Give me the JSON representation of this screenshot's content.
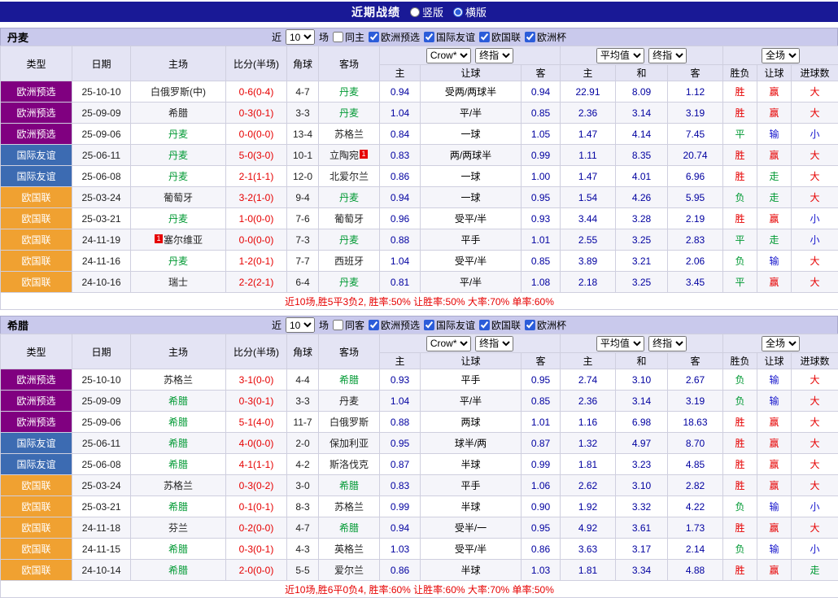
{
  "top_bar": {
    "title": "近期战绩",
    "layout_options": [
      {
        "label": "竖版",
        "selected": false
      },
      {
        "label": "横版",
        "selected": true
      }
    ]
  },
  "filter": {
    "near_label": "近",
    "count_value": "10",
    "games_label": "场",
    "league_filters": [
      {
        "label": "欧洲预选",
        "checked": true
      },
      {
        "label": "国际友谊",
        "checked": true
      },
      {
        "label": "欧国联",
        "checked": true
      },
      {
        "label": "欧洲杯",
        "checked": true
      }
    ]
  },
  "table_header": {
    "type": "类型",
    "date": "日期",
    "home": "主场",
    "score": "比分(半场)",
    "corner": "角球",
    "away": "客场",
    "odds_select": "Crow*",
    "odds_stage_select": "终指",
    "avg_select": "平均值",
    "avg_stage_select": "终指",
    "scope_select": "全场",
    "odds_home": "主",
    "odds_handicap": "让球",
    "odds_away": "客",
    "avg_home": "主",
    "avg_draw": "和",
    "avg_away": "客",
    "result": "胜负",
    "handicap_result": "让球",
    "goals": "进球数"
  },
  "colors": {
    "badges": {
      "欧洲预选": "#800080",
      "国际友谊": "#3c6bb2",
      "欧国联": "#f0a131"
    },
    "result": {
      "r": "#e60000",
      "g": "#009933",
      "b": "#1515cc"
    },
    "focus_team": "#009933",
    "score": "#e60000",
    "odds": "#0000a0",
    "topbar_bg": "#191996",
    "section_bar_bg": "#c9c9ec",
    "header_bg": "#e4e4f4"
  },
  "sections": [
    {
      "team": "丹麦",
      "same_side_label": "同主",
      "same_side_checked": false,
      "summary": "近10场,胜5平3负2, 胜率:50% 让胜率:50% 大率:70% 单率:60%",
      "rows": [
        {
          "type": "欧洲预选",
          "date": "25-10-10",
          "home": "白俄罗斯(中)",
          "home_focus": false,
          "home_card": "",
          "score": "0-6(0-4)",
          "corner": "4-7",
          "away": "丹麦",
          "away_focus": true,
          "away_card": "",
          "odds": [
            "0.94",
            "受两/两球半",
            "0.94"
          ],
          "avg": [
            "22.91",
            "8.09",
            "1.12"
          ],
          "results": [
            {
              "t": "胜",
              "c": "r"
            },
            {
              "t": "赢",
              "c": "r"
            },
            {
              "t": "大",
              "c": "r"
            }
          ]
        },
        {
          "type": "欧洲预选",
          "date": "25-09-09",
          "home": "希腊",
          "home_focus": false,
          "home_card": "",
          "score": "0-3(0-1)",
          "corner": "3-3",
          "away": "丹麦",
          "away_focus": true,
          "away_card": "",
          "odds": [
            "1.04",
            "平/半",
            "0.85"
          ],
          "avg": [
            "2.36",
            "3.14",
            "3.19"
          ],
          "results": [
            {
              "t": "胜",
              "c": "r"
            },
            {
              "t": "赢",
              "c": "r"
            },
            {
              "t": "大",
              "c": "r"
            }
          ]
        },
        {
          "type": "欧洲预选",
          "date": "25-09-06",
          "home": "丹麦",
          "home_focus": true,
          "home_card": "",
          "score": "0-0(0-0)",
          "corner": "13-4",
          "away": "苏格兰",
          "away_focus": false,
          "away_card": "",
          "odds": [
            "0.84",
            "一球",
            "1.05"
          ],
          "avg": [
            "1.47",
            "4.14",
            "7.45"
          ],
          "results": [
            {
              "t": "平",
              "c": "g"
            },
            {
              "t": "输",
              "c": "b"
            },
            {
              "t": "小",
              "c": "b"
            }
          ]
        },
        {
          "type": "国际友谊",
          "date": "25-06-11",
          "home": "丹麦",
          "home_focus": true,
          "home_card": "",
          "score": "5-0(3-0)",
          "corner": "10-1",
          "away": "立陶宛",
          "away_focus": false,
          "away_card": "1",
          "odds": [
            "0.83",
            "两/两球半",
            "0.99"
          ],
          "avg": [
            "1.11",
            "8.35",
            "20.74"
          ],
          "results": [
            {
              "t": "胜",
              "c": "r"
            },
            {
              "t": "赢",
              "c": "r"
            },
            {
              "t": "大",
              "c": "r"
            }
          ]
        },
        {
          "type": "国际友谊",
          "date": "25-06-08",
          "home": "丹麦",
          "home_focus": true,
          "home_card": "",
          "score": "2-1(1-1)",
          "corner": "12-0",
          "away": "北爱尔兰",
          "away_focus": false,
          "away_card": "",
          "odds": [
            "0.86",
            "一球",
            "1.00"
          ],
          "avg": [
            "1.47",
            "4.01",
            "6.96"
          ],
          "results": [
            {
              "t": "胜",
              "c": "r"
            },
            {
              "t": "走",
              "c": "g"
            },
            {
              "t": "大",
              "c": "r"
            }
          ]
        },
        {
          "type": "欧国联",
          "date": "25-03-24",
          "home": "葡萄牙",
          "home_focus": false,
          "home_card": "",
          "score": "3-2(1-0)",
          "corner": "9-4",
          "away": "丹麦",
          "away_focus": true,
          "away_card": "",
          "odds": [
            "0.94",
            "一球",
            "0.95"
          ],
          "avg": [
            "1.54",
            "4.26",
            "5.95"
          ],
          "results": [
            {
              "t": "负",
              "c": "g"
            },
            {
              "t": "走",
              "c": "g"
            },
            {
              "t": "大",
              "c": "r"
            }
          ]
        },
        {
          "type": "欧国联",
          "date": "25-03-21",
          "home": "丹麦",
          "home_focus": true,
          "home_card": "",
          "score": "1-0(0-0)",
          "corner": "7-6",
          "away": "葡萄牙",
          "away_focus": false,
          "away_card": "",
          "odds": [
            "0.96",
            "受平/半",
            "0.93"
          ],
          "avg": [
            "3.44",
            "3.28",
            "2.19"
          ],
          "results": [
            {
              "t": "胜",
              "c": "r"
            },
            {
              "t": "赢",
              "c": "r"
            },
            {
              "t": "小",
              "c": "b"
            }
          ]
        },
        {
          "type": "欧国联",
          "date": "24-11-19",
          "home": "塞尔维亚",
          "home_focus": false,
          "home_card": "1",
          "score": "0-0(0-0)",
          "corner": "7-3",
          "away": "丹麦",
          "away_focus": true,
          "away_card": "",
          "odds": [
            "0.88",
            "平手",
            "1.01"
          ],
          "avg": [
            "2.55",
            "3.25",
            "2.83"
          ],
          "results": [
            {
              "t": "平",
              "c": "g"
            },
            {
              "t": "走",
              "c": "g"
            },
            {
              "t": "小",
              "c": "b"
            }
          ]
        },
        {
          "type": "欧国联",
          "date": "24-11-16",
          "home": "丹麦",
          "home_focus": true,
          "home_card": "",
          "score": "1-2(0-1)",
          "corner": "7-7",
          "away": "西班牙",
          "away_focus": false,
          "away_card": "",
          "odds": [
            "1.04",
            "受平/半",
            "0.85"
          ],
          "avg": [
            "3.89",
            "3.21",
            "2.06"
          ],
          "results": [
            {
              "t": "负",
              "c": "g"
            },
            {
              "t": "输",
              "c": "b"
            },
            {
              "t": "大",
              "c": "r"
            }
          ]
        },
        {
          "type": "欧国联",
          "date": "24-10-16",
          "home": "瑞士",
          "home_focus": false,
          "home_card": "",
          "score": "2-2(2-1)",
          "corner": "6-4",
          "away": "丹麦",
          "away_focus": true,
          "away_card": "",
          "odds": [
            "0.81",
            "平/半",
            "1.08"
          ],
          "avg": [
            "2.18",
            "3.25",
            "3.45"
          ],
          "results": [
            {
              "t": "平",
              "c": "g"
            },
            {
              "t": "赢",
              "c": "r"
            },
            {
              "t": "大",
              "c": "r"
            }
          ]
        }
      ]
    },
    {
      "team": "希腊",
      "same_side_label": "同客",
      "same_side_checked": false,
      "summary": "近10场,胜6平0负4, 胜率:60% 让胜率:60% 大率:70% 单率:50%",
      "rows": [
        {
          "type": "欧洲预选",
          "date": "25-10-10",
          "home": "苏格兰",
          "home_focus": false,
          "home_card": "",
          "score": "3-1(0-0)",
          "corner": "4-4",
          "away": "希腊",
          "away_focus": true,
          "away_card": "",
          "odds": [
            "0.93",
            "平手",
            "0.95"
          ],
          "avg": [
            "2.74",
            "3.10",
            "2.67"
          ],
          "results": [
            {
              "t": "负",
              "c": "g"
            },
            {
              "t": "输",
              "c": "b"
            },
            {
              "t": "大",
              "c": "r"
            }
          ]
        },
        {
          "type": "欧洲预选",
          "date": "25-09-09",
          "home": "希腊",
          "home_focus": true,
          "home_card": "",
          "score": "0-3(0-1)",
          "corner": "3-3",
          "away": "丹麦",
          "away_focus": false,
          "away_card": "",
          "odds": [
            "1.04",
            "平/半",
            "0.85"
          ],
          "avg": [
            "2.36",
            "3.14",
            "3.19"
          ],
          "results": [
            {
              "t": "负",
              "c": "g"
            },
            {
              "t": "输",
              "c": "b"
            },
            {
              "t": "大",
              "c": "r"
            }
          ]
        },
        {
          "type": "欧洲预选",
          "date": "25-09-06",
          "home": "希腊",
          "home_focus": true,
          "home_card": "",
          "score": "5-1(4-0)",
          "corner": "11-7",
          "away": "白俄罗斯",
          "away_focus": false,
          "away_card": "",
          "odds": [
            "0.88",
            "两球",
            "1.01"
          ],
          "avg": [
            "1.16",
            "6.98",
            "18.63"
          ],
          "results": [
            {
              "t": "胜",
              "c": "r"
            },
            {
              "t": "赢",
              "c": "r"
            },
            {
              "t": "大",
              "c": "r"
            }
          ]
        },
        {
          "type": "国际友谊",
          "date": "25-06-11",
          "home": "希腊",
          "home_focus": true,
          "home_card": "",
          "score": "4-0(0-0)",
          "corner": "2-0",
          "away": "保加利亚",
          "away_focus": false,
          "away_card": "",
          "odds": [
            "0.95",
            "球半/两",
            "0.87"
          ],
          "avg": [
            "1.32",
            "4.97",
            "8.70"
          ],
          "results": [
            {
              "t": "胜",
              "c": "r"
            },
            {
              "t": "赢",
              "c": "r"
            },
            {
              "t": "大",
              "c": "r"
            }
          ]
        },
        {
          "type": "国际友谊",
          "date": "25-06-08",
          "home": "希腊",
          "home_focus": true,
          "home_card": "",
          "score": "4-1(1-1)",
          "corner": "4-2",
          "away": "斯洛伐克",
          "away_focus": false,
          "away_card": "",
          "odds": [
            "0.87",
            "半球",
            "0.99"
          ],
          "avg": [
            "1.81",
            "3.23",
            "4.85"
          ],
          "results": [
            {
              "t": "胜",
              "c": "r"
            },
            {
              "t": "赢",
              "c": "r"
            },
            {
              "t": "大",
              "c": "r"
            }
          ]
        },
        {
          "type": "欧国联",
          "date": "25-03-24",
          "home": "苏格兰",
          "home_focus": false,
          "home_card": "",
          "score": "0-3(0-2)",
          "corner": "3-0",
          "away": "希腊",
          "away_focus": true,
          "away_card": "",
          "odds": [
            "0.83",
            "平手",
            "1.06"
          ],
          "avg": [
            "2.62",
            "3.10",
            "2.82"
          ],
          "results": [
            {
              "t": "胜",
              "c": "r"
            },
            {
              "t": "赢",
              "c": "r"
            },
            {
              "t": "大",
              "c": "r"
            }
          ]
        },
        {
          "type": "欧国联",
          "date": "25-03-21",
          "home": "希腊",
          "home_focus": true,
          "home_card": "",
          "score": "0-1(0-1)",
          "corner": "8-3",
          "away": "苏格兰",
          "away_focus": false,
          "away_card": "",
          "odds": [
            "0.99",
            "半球",
            "0.90"
          ],
          "avg": [
            "1.92",
            "3.32",
            "4.22"
          ],
          "results": [
            {
              "t": "负",
              "c": "g"
            },
            {
              "t": "输",
              "c": "b"
            },
            {
              "t": "小",
              "c": "b"
            }
          ]
        },
        {
          "type": "欧国联",
          "date": "24-11-18",
          "home": "芬兰",
          "home_focus": false,
          "home_card": "",
          "score": "0-2(0-0)",
          "corner": "4-7",
          "away": "希腊",
          "away_focus": true,
          "away_card": "",
          "odds": [
            "0.94",
            "受半/一",
            "0.95"
          ],
          "avg": [
            "4.92",
            "3.61",
            "1.73"
          ],
          "results": [
            {
              "t": "胜",
              "c": "r"
            },
            {
              "t": "赢",
              "c": "r"
            },
            {
              "t": "大",
              "c": "r"
            }
          ]
        },
        {
          "type": "欧国联",
          "date": "24-11-15",
          "home": "希腊",
          "home_focus": true,
          "home_card": "",
          "score": "0-3(0-1)",
          "corner": "4-3",
          "away": "英格兰",
          "away_focus": false,
          "away_card": "",
          "odds": [
            "1.03",
            "受平/半",
            "0.86"
          ],
          "avg": [
            "3.63",
            "3.17",
            "2.14"
          ],
          "results": [
            {
              "t": "负",
              "c": "g"
            },
            {
              "t": "输",
              "c": "b"
            },
            {
              "t": "小",
              "c": "b"
            }
          ]
        },
        {
          "type": "欧国联",
          "date": "24-10-14",
          "home": "希腊",
          "home_focus": true,
          "home_card": "",
          "score": "2-0(0-0)",
          "corner": "5-5",
          "away": "爱尔兰",
          "away_focus": false,
          "away_card": "",
          "odds": [
            "0.86",
            "半球",
            "1.03"
          ],
          "avg": [
            "1.81",
            "3.34",
            "4.88"
          ],
          "results": [
            {
              "t": "胜",
              "c": "r"
            },
            {
              "t": "赢",
              "c": "r"
            },
            {
              "t": "走",
              "c": "g"
            }
          ]
        }
      ]
    }
  ]
}
